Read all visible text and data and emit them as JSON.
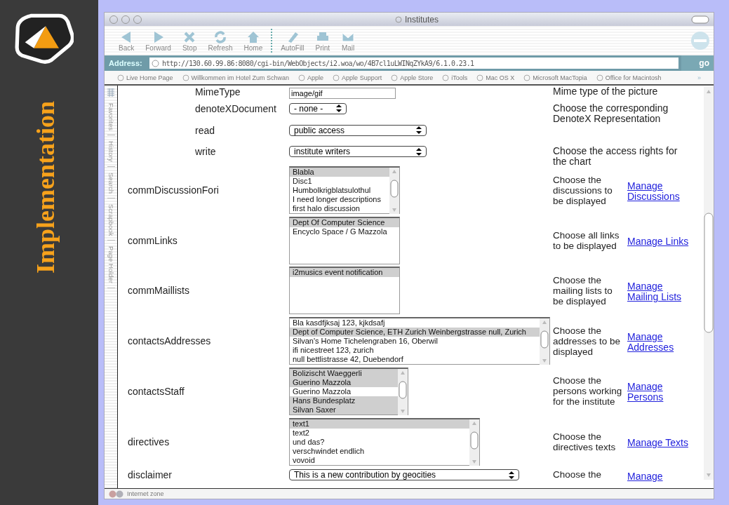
{
  "slide": {
    "title": "Implementation"
  },
  "window": {
    "title": "Institutes"
  },
  "toolbar": [
    "Back",
    "Forward",
    "Stop",
    "Refresh",
    "Home",
    "AutoFill",
    "Print",
    "Mail"
  ],
  "address": {
    "label": "Address:",
    "value": "http://130.60.99.86:8080/cgi-bin/WebObjects/i2.woa/wo/4B7cl1uLWINqZYkA9/6.1.0.23.1",
    "go": "go"
  },
  "favorites": [
    "Live Home Page",
    "Willkommen im Hotel Zum Schwan",
    "Apple",
    "Apple Support",
    "Apple Store",
    "iTools",
    "Mac OS X",
    "Microsoft MacTopia",
    "Office for Macintosh"
  ],
  "favorites_more": "»",
  "side_tabs": [
    "Favorites",
    "History",
    "Search",
    "Scrapbook",
    "Page Holder"
  ],
  "rows": [
    {
      "label": "MimeType",
      "kind": "text",
      "value": "image/gif",
      "description": "Mime type of the picture"
    },
    {
      "label": "denoteXDocument",
      "kind": "select",
      "value": "- none -",
      "description": "Choose the corresponding DenoteX Representation"
    },
    {
      "label": "read",
      "kind": "select",
      "value": "public access"
    },
    {
      "label": "write",
      "kind": "select",
      "value": "institute writers",
      "description": "Choose the access rights for the chart"
    },
    {
      "label": "commDiscussionFori",
      "kind": "list",
      "scrollbar": true,
      "items": [
        {
          "text": "Blabla",
          "selected": true
        },
        {
          "text": "Disc1",
          "selected": false
        },
        {
          "text": "Humbolkrigblatsulothul",
          "selected": false
        },
        {
          "text": "I need longer descriptions",
          "selected": false
        },
        {
          "text": "first halo discussion",
          "selected": false
        }
      ],
      "description": "Choose the discussions to be displayed",
      "link": "Manage Discussions"
    },
    {
      "label": "commLinks",
      "kind": "list",
      "scrollbar": false,
      "items": [
        {
          "text": "Dept Of Computer Science",
          "selected": true
        },
        {
          "text": "Encyclo Space / G Mazzola",
          "selected": false
        }
      ],
      "description": "Choose all links to be displayed",
      "link": "Manage Links"
    },
    {
      "label": "commMaillists",
      "kind": "list",
      "scrollbar": false,
      "items": [
        {
          "text": "i2musics event notification",
          "selected": true
        }
      ],
      "description": "Choose the mailing lists to be displayed",
      "link": "Manage Mailing Lists"
    },
    {
      "label": "contactsAddresses",
      "kind": "list",
      "scrollbar": true,
      "items": [
        {
          "text": "Bla kasdfjksaj 123, kjkdsafj",
          "selected": false
        },
        {
          "text": "Dept of Computer Science, ETH Zurich Weinbergstrasse null, Zurich",
          "selected": true
        },
        {
          "text": "Silvan's Home Tichelengraben 16, Oberwil",
          "selected": false
        },
        {
          "text": "ifi nicestreet 123, zurich",
          "selected": false
        },
        {
          "text": "null bettlistrasse 42, Duebendorf",
          "selected": false
        }
      ],
      "description": "Choose the addresses to be displayed",
      "link": "Manage Addresses"
    },
    {
      "label": "contactsStaff",
      "kind": "list",
      "scrollbar": true,
      "items": [
        {
          "text": "Bolizischt Waeggerli",
          "selected": true
        },
        {
          "text": "Guerino Mazzola",
          "selected": true
        },
        {
          "text": "Guerino Mazzola",
          "selected": false
        },
        {
          "text": "Hans Bundesplatz",
          "selected": true
        },
        {
          "text": "Silvan Saxer",
          "selected": true
        }
      ],
      "description": "Choose the persons working for the institute",
      "link": "Manage Persons"
    },
    {
      "label": "directives",
      "kind": "list",
      "scrollbar": true,
      "items": [
        {
          "text": "text1",
          "selected": true
        },
        {
          "text": "text2",
          "selected": false
        },
        {
          "text": "und das?",
          "selected": false
        },
        {
          "text": "verschwindet endlich",
          "selected": false
        },
        {
          "text": "vovoid",
          "selected": false
        }
      ],
      "description": "Choose the directives texts",
      "link": "Manage Texts"
    },
    {
      "label": "disclaimer",
      "kind": "select",
      "value": "This is a new contribution by geocities",
      "description": "Choose the",
      "link": "Manage"
    }
  ],
  "status_bar": "Internet zone"
}
